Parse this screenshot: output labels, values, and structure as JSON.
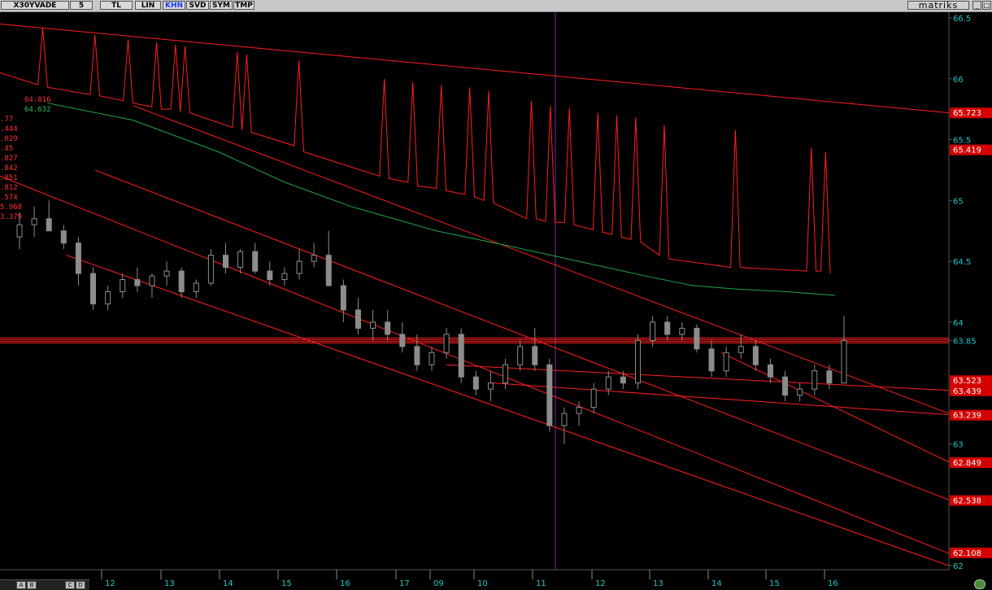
{
  "toolbar": {
    "symbol": "X30YVADE",
    "buttons": [
      {
        "label": "5",
        "active": false
      },
      {
        "label": "TL",
        "active": false
      },
      {
        "label": "LIN",
        "active": false
      },
      {
        "label": "KHN",
        "active": true
      },
      {
        "label": "SVD",
        "active": false
      },
      {
        "label": "SYM",
        "active": false
      },
      {
        "label": "TMP",
        "active": false
      }
    ],
    "logo": "matriks"
  },
  "legend": {
    "items": [
      {
        "text": "64.816",
        "color": "#ff3030"
      },
      {
        "text": "64.632",
        "color": "#25c050"
      },
      {
        "text": ".77",
        "color": "#ff3030"
      },
      {
        "text": ".444",
        "color": "#ff3030"
      },
      {
        "text": ".029",
        "color": "#ff3030"
      },
      {
        "text": ".45",
        "color": "#ff3030"
      },
      {
        "text": ".827",
        "color": "#ff3030"
      },
      {
        "text": ".842",
        "color": "#ff3030"
      },
      {
        "text": ".851",
        "color": "#ff3030"
      },
      {
        "text": ".812",
        "color": "#ff3030"
      },
      {
        "text": ".574",
        "color": "#ff3030"
      },
      {
        "text": "5.968",
        "color": "#ff3030"
      },
      {
        "text": "3.379",
        "color": "#ff3030"
      }
    ]
  },
  "colors": {
    "background": "#000000",
    "trendline": "#ff1e1e",
    "moving_average": "#21a548",
    "candle": "#8c8c8c",
    "cursor": "#7a2aa8",
    "axis_text": "#e0e0e0",
    "price_tag_bg": "#d40000"
  },
  "chart_data": {
    "type": "candlestick",
    "symbol": "X30YVADE",
    "y_axis": {
      "ticks": [
        "66.5",
        "66",
        "65.5",
        "65",
        "64.5",
        "64",
        "63.85",
        "63",
        "62"
      ],
      "min": 62,
      "max": 66.5,
      "price_labels": [
        "65.723",
        "65.419",
        "63.523",
        "63.439",
        "63.239",
        "62.849",
        "62.538",
        "62.108"
      ]
    },
    "x_axis": {
      "ticks": [
        "12",
        "13",
        "14",
        "15",
        "16",
        "17",
        "09",
        "10",
        "11",
        "12",
        "13",
        "14",
        "15",
        "16"
      ]
    },
    "horizontal_level": 63.85,
    "moving_average": {
      "name": "64.632",
      "points": [
        [
          0.05,
          65.8
        ],
        [
          0.14,
          65.66
        ],
        [
          0.23,
          65.4
        ],
        [
          0.3,
          65.15
        ],
        [
          0.37,
          64.95
        ],
        [
          0.46,
          64.75
        ],
        [
          0.54,
          64.62
        ],
        [
          0.61,
          64.5
        ],
        [
          0.68,
          64.38
        ],
        [
          0.73,
          64.3
        ],
        [
          0.78,
          64.27
        ],
        [
          0.83,
          64.25
        ],
        [
          0.88,
          64.22
        ]
      ]
    },
    "upper_series": {
      "name": "64.816",
      "points": [
        [
          0.0,
          66.05
        ],
        [
          0.04,
          65.95
        ],
        [
          0.045,
          66.42
        ],
        [
          0.05,
          65.93
        ],
        [
          0.095,
          65.87
        ],
        [
          0.1,
          66.36
        ],
        [
          0.105,
          65.86
        ],
        [
          0.13,
          65.82
        ],
        [
          0.135,
          66.32
        ],
        [
          0.14,
          65.8
        ],
        [
          0.16,
          65.77
        ],
        [
          0.165,
          66.3
        ],
        [
          0.17,
          65.75
        ],
        [
          0.18,
          65.75
        ],
        [
          0.185,
          66.28
        ],
        [
          0.19,
          65.73
        ],
        [
          0.195,
          66.27
        ],
        [
          0.2,
          65.72
        ],
        [
          0.245,
          65.6
        ],
        [
          0.25,
          66.22
        ],
        [
          0.255,
          65.58
        ],
        [
          0.26,
          66.2
        ],
        [
          0.265,
          65.56
        ],
        [
          0.31,
          65.45
        ],
        [
          0.315,
          66.15
        ],
        [
          0.32,
          65.4
        ],
        [
          0.4,
          65.2
        ],
        [
          0.405,
          66.0
        ],
        [
          0.41,
          65.18
        ],
        [
          0.43,
          65.15
        ],
        [
          0.435,
          65.97
        ],
        [
          0.44,
          65.12
        ],
        [
          0.46,
          65.1
        ],
        [
          0.465,
          65.95
        ],
        [
          0.47,
          65.08
        ],
        [
          0.49,
          65.05
        ],
        [
          0.495,
          65.93
        ],
        [
          0.5,
          65.03
        ],
        [
          0.51,
          65.0
        ],
        [
          0.515,
          65.9
        ],
        [
          0.52,
          64.98
        ],
        [
          0.555,
          64.85
        ],
        [
          0.56,
          65.82
        ],
        [
          0.565,
          64.85
        ],
        [
          0.575,
          64.83
        ],
        [
          0.58,
          65.78
        ],
        [
          0.585,
          64.82
        ],
        [
          0.595,
          64.82
        ],
        [
          0.6,
          65.76
        ],
        [
          0.605,
          64.8
        ],
        [
          0.625,
          64.76
        ],
        [
          0.63,
          65.72
        ],
        [
          0.635,
          64.74
        ],
        [
          0.645,
          64.72
        ],
        [
          0.65,
          65.7
        ],
        [
          0.655,
          64.7
        ],
        [
          0.665,
          64.68
        ],
        [
          0.67,
          65.68
        ],
        [
          0.675,
          64.66
        ],
        [
          0.695,
          64.55
        ],
        [
          0.7,
          65.62
        ],
        [
          0.705,
          64.52
        ],
        [
          0.77,
          64.45
        ],
        [
          0.775,
          65.58
        ],
        [
          0.78,
          64.45
        ],
        [
          0.85,
          64.42
        ],
        [
          0.855,
          65.43
        ],
        [
          0.86,
          64.42
        ],
        [
          0.865,
          64.42
        ],
        [
          0.87,
          65.4
        ],
        [
          0.875,
          64.4
        ]
      ]
    },
    "trendlines": [
      {
        "from": [
          0.0,
          66.45
        ],
        "to": [
          1.0,
          65.72
        ]
      },
      {
        "from": [
          0.14,
          65.78
        ],
        "to": [
          1.0,
          63.25
        ]
      },
      {
        "from": [
          0.0,
          65.2
        ],
        "to": [
          1.0,
          62.1
        ]
      },
      {
        "from": [
          0.1,
          65.25
        ],
        "to": [
          1.0,
          62.54
        ]
      },
      {
        "from": [
          0.07,
          64.55
        ],
        "to": [
          1.0,
          62.0
        ]
      },
      {
        "from": [
          0.47,
          63.65
        ],
        "to": [
          1.0,
          63.44
        ]
      },
      {
        "from": [
          0.52,
          63.5
        ],
        "to": [
          1.0,
          63.24
        ]
      },
      {
        "from": [
          0.76,
          63.75
        ],
        "to": [
          1.0,
          62.85
        ]
      }
    ],
    "candles": [
      [
        64.7,
        64.9,
        64.6,
        64.8
      ],
      [
        64.8,
        64.95,
        64.7,
        64.85
      ],
      [
        64.85,
        65.0,
        64.8,
        64.75
      ],
      [
        64.75,
        64.8,
        64.6,
        64.65
      ],
      [
        64.65,
        64.7,
        64.3,
        64.4
      ],
      [
        64.4,
        64.45,
        64.1,
        64.15
      ],
      [
        64.15,
        64.3,
        64.1,
        64.25
      ],
      [
        64.25,
        64.4,
        64.2,
        64.35
      ],
      [
        64.35,
        64.45,
        64.25,
        64.3
      ],
      [
        64.3,
        64.4,
        64.2,
        64.38
      ],
      [
        64.38,
        64.5,
        64.3,
        64.42
      ],
      [
        64.42,
        64.45,
        64.2,
        64.25
      ],
      [
        64.25,
        64.35,
        64.2,
        64.32
      ],
      [
        64.32,
        64.6,
        64.3,
        64.55
      ],
      [
        64.55,
        64.65,
        64.4,
        64.45
      ],
      [
        64.45,
        64.6,
        64.4,
        64.58
      ],
      [
        64.58,
        64.65,
        64.4,
        64.42
      ],
      [
        64.42,
        64.5,
        64.3,
        64.35
      ],
      [
        64.35,
        64.45,
        64.3,
        64.4
      ],
      [
        64.4,
        64.6,
        64.35,
        64.5
      ],
      [
        64.5,
        64.65,
        64.45,
        64.55
      ],
      [
        64.55,
        64.75,
        64.3,
        64.3
      ],
      [
        64.3,
        64.35,
        64.0,
        64.1
      ],
      [
        64.1,
        64.2,
        63.9,
        63.95
      ],
      [
        63.95,
        64.1,
        63.85,
        64.0
      ],
      [
        64.0,
        64.1,
        63.85,
        63.9
      ],
      [
        63.9,
        64.0,
        63.75,
        63.8
      ],
      [
        63.8,
        63.9,
        63.6,
        63.65
      ],
      [
        63.65,
        63.8,
        63.6,
        63.75
      ],
      [
        63.75,
        63.95,
        63.7,
        63.9
      ],
      [
        63.9,
        63.95,
        63.5,
        63.55
      ],
      [
        63.55,
        63.6,
        63.4,
        63.45
      ],
      [
        63.45,
        63.6,
        63.35,
        63.5
      ],
      [
        63.5,
        63.7,
        63.45,
        63.65
      ],
      [
        63.65,
        63.85,
        63.6,
        63.8
      ],
      [
        63.8,
        63.95,
        63.6,
        63.65
      ],
      [
        63.65,
        63.7,
        63.1,
        63.15
      ],
      [
        63.15,
        63.3,
        63.0,
        63.25
      ],
      [
        63.25,
        63.35,
        63.15,
        63.3
      ],
      [
        63.3,
        63.5,
        63.25,
        63.45
      ],
      [
        63.45,
        63.6,
        63.4,
        63.55
      ],
      [
        63.55,
        63.6,
        63.45,
        63.5
      ],
      [
        63.5,
        63.9,
        63.45,
        63.85
      ],
      [
        63.85,
        64.05,
        63.8,
        64.0
      ],
      [
        64.0,
        64.05,
        63.85,
        63.9
      ],
      [
        63.9,
        64.0,
        63.85,
        63.95
      ],
      [
        63.95,
        63.98,
        63.75,
        63.78
      ],
      [
        63.78,
        63.85,
        63.55,
        63.6
      ],
      [
        63.6,
        63.8,
        63.55,
        63.75
      ],
      [
        63.75,
        63.9,
        63.7,
        63.8
      ],
      [
        63.8,
        63.85,
        63.6,
        63.65
      ],
      [
        63.65,
        63.7,
        63.5,
        63.55
      ],
      [
        63.55,
        63.6,
        63.35,
        63.4
      ],
      [
        63.4,
        63.5,
        63.35,
        63.45
      ],
      [
        63.45,
        63.65,
        63.4,
        63.6
      ],
      [
        63.6,
        63.65,
        63.45,
        63.5
      ],
      [
        63.5,
        64.05,
        63.5,
        63.85
      ]
    ]
  },
  "bottom_bar": {
    "buttons": [
      "A",
      "B",
      "C",
      "D"
    ]
  }
}
